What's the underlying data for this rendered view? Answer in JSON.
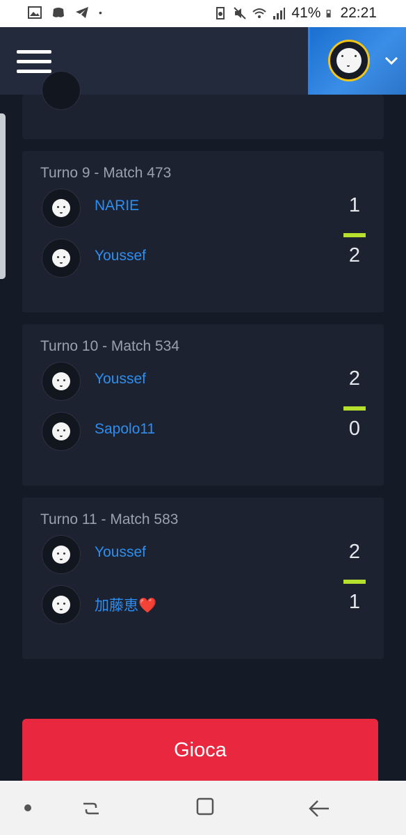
{
  "status_bar": {
    "battery": "41%",
    "time": "22:21"
  },
  "header": {
    "menu_icon": "hamburger-menu-icon",
    "account_icon": "chevron-down-icon"
  },
  "matches": [
    {
      "title": "Turno 9 - Match 473",
      "players": [
        {
          "name": "NARIE",
          "score": "1"
        },
        {
          "name": "Youssef",
          "score": "2"
        }
      ],
      "winner_index": 1
    },
    {
      "title": "Turno 10 - Match 534",
      "players": [
        {
          "name": "Youssef",
          "score": "2"
        },
        {
          "name": "Sapolo11",
          "score": "0"
        }
      ],
      "winner_index": 0
    },
    {
      "title": "Turno 11 - Match 583",
      "players": [
        {
          "name": "Youssef",
          "score": "2"
        },
        {
          "name": "加藤恵❤️",
          "score": "1"
        }
      ],
      "winner_index": 0
    }
  ],
  "actions": {
    "play_label": "Gioca"
  },
  "colors": {
    "accent_win": "#b6e02e",
    "player_link": "#2d8ef0",
    "play_button": "#e9283f"
  }
}
